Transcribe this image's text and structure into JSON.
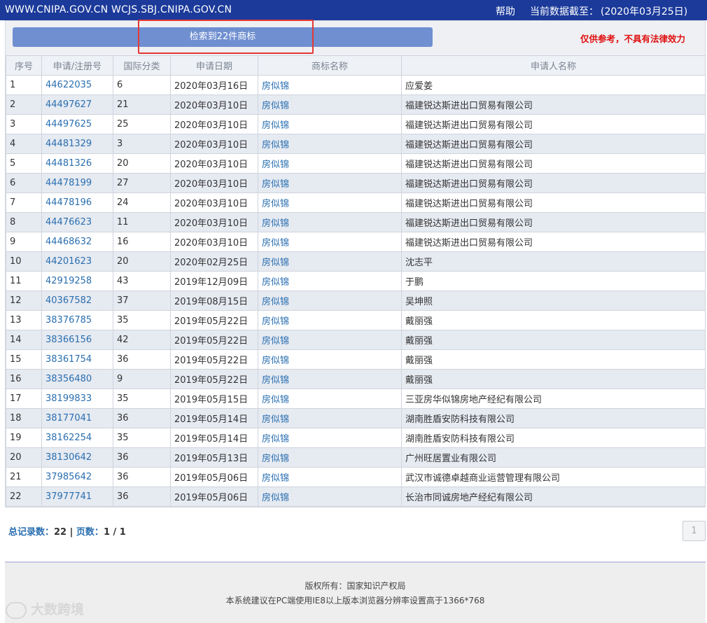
{
  "header": {
    "sites": "WWW.CNIPA.GOV.CN WCJS.SBJ.CNIPA.GOV.CN",
    "help": "帮助",
    "as_of_label": "当前数据截至：",
    "as_of_date": "(2020年03月25日)"
  },
  "result_bar": {
    "label": "检索到22件商标"
  },
  "disclaimer": "仅供参考，不具有法律效力",
  "table": {
    "headers": [
      "序号",
      "申请/注册号",
      "国际分类",
      "申请日期",
      "商标名称",
      "申请人名称"
    ],
    "rows": [
      [
        "1",
        "44622035",
        "6",
        "2020年03月16日",
        "房似锦",
        "应爱姜"
      ],
      [
        "2",
        "44497627",
        "21",
        "2020年03月10日",
        "房似锦",
        "福建锐达斯进出口贸易有限公司"
      ],
      [
        "3",
        "44497625",
        "25",
        "2020年03月10日",
        "房似锦",
        "福建锐达斯进出口贸易有限公司"
      ],
      [
        "4",
        "44481329",
        "3",
        "2020年03月10日",
        "房似锦",
        "福建锐达斯进出口贸易有限公司"
      ],
      [
        "5",
        "44481326",
        "20",
        "2020年03月10日",
        "房似锦",
        "福建锐达斯进出口贸易有限公司"
      ],
      [
        "6",
        "44478199",
        "27",
        "2020年03月10日",
        "房似锦",
        "福建锐达斯进出口贸易有限公司"
      ],
      [
        "7",
        "44478196",
        "24",
        "2020年03月10日",
        "房似锦",
        "福建锐达斯进出口贸易有限公司"
      ],
      [
        "8",
        "44476623",
        "11",
        "2020年03月10日",
        "房似锦",
        "福建锐达斯进出口贸易有限公司"
      ],
      [
        "9",
        "44468632",
        "16",
        "2020年03月10日",
        "房似锦",
        "福建锐达斯进出口贸易有限公司"
      ],
      [
        "10",
        "44201623",
        "20",
        "2020年02月25日",
        "房似锦",
        "沈志平"
      ],
      [
        "11",
        "42919258",
        "43",
        "2019年12月09日",
        "房似锦",
        "于鹏"
      ],
      [
        "12",
        "40367582",
        "37",
        "2019年08月15日",
        "房似锦",
        "吴坤照"
      ],
      [
        "13",
        "38376785",
        "35",
        "2019年05月22日",
        "房似锦",
        "戴丽强"
      ],
      [
        "14",
        "38366156",
        "42",
        "2019年05月22日",
        "房似锦",
        "戴丽强"
      ],
      [
        "15",
        "38361754",
        "36",
        "2019年05月22日",
        "房似锦",
        "戴丽强"
      ],
      [
        "16",
        "38356480",
        "9",
        "2019年05月22日",
        "房似锦",
        "戴丽强"
      ],
      [
        "17",
        "38199833",
        "35",
        "2019年05月15日",
        "房似锦",
        "三亚房华似锦房地产经纪有限公司"
      ],
      [
        "18",
        "38177041",
        "36",
        "2019年05月14日",
        "房似锦",
        "湖南胜盾安防科技有限公司"
      ],
      [
        "19",
        "38162254",
        "35",
        "2019年05月14日",
        "房似锦",
        "湖南胜盾安防科技有限公司"
      ],
      [
        "20",
        "38130642",
        "36",
        "2019年05月13日",
        "房似锦",
        "广州旺居置业有限公司"
      ],
      [
        "21",
        "37985642",
        "36",
        "2019年05月06日",
        "房似锦",
        "武汉市诚德卓越商业运营管理有限公司"
      ],
      [
        "22",
        "37977741",
        "36",
        "2019年05月06日",
        "房似锦",
        "长治市同诚房地产经纪有限公司"
      ]
    ]
  },
  "summary": {
    "total_label": "总记录数：",
    "total": "22",
    "sep": "|",
    "pages_label": "页数：",
    "pages": "1 / 1"
  },
  "pagination": {
    "current": "1"
  },
  "footer": {
    "copyright": "版权所有：国家知识产权局",
    "browser_note": "本系统建议在PC端使用IE8以上版本浏览器分辨率设置高于1366*768"
  },
  "watermark": {
    "text": "大数跨境"
  },
  "colors": {
    "topbar": "#1b3a9a",
    "link": "#2a6fb0",
    "result_bar": "#6f8fd0",
    "disclaimer": "#e01010",
    "highlight_box": "#e53935"
  }
}
